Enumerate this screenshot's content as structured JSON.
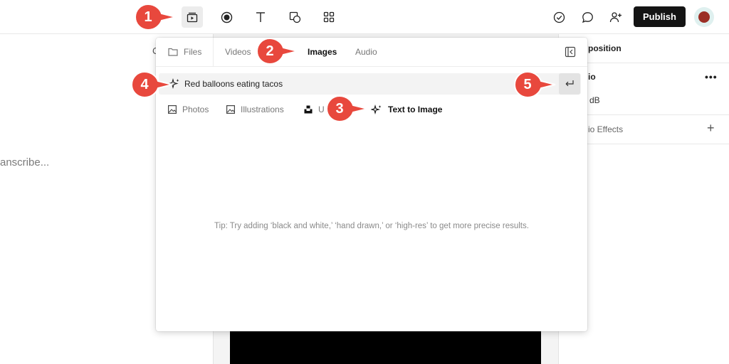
{
  "toolbar": {
    "publish_label": "Publish"
  },
  "background": {
    "transcribe_text": "anscribe...",
    "left_fragment": "C"
  },
  "right_panel": {
    "composition_title": "position",
    "audio_title": "io",
    "volume_unit": "dB",
    "effects_label": "io Effects",
    "more_label": "•••",
    "add_label": "+"
  },
  "media_panel": {
    "tabs": [
      {
        "label": "Files",
        "icon": "folder-icon"
      },
      {
        "label": "Videos"
      },
      {
        "label": "Images",
        "active": true
      },
      {
        "label": "Audio"
      }
    ],
    "search": {
      "value": "Red balloons eating tacos",
      "placeholder": ""
    },
    "sources": [
      {
        "label": "Photos",
        "icon": "image-icon"
      },
      {
        "label": "Illustrations",
        "icon": "image-icon"
      },
      {
        "label": "U",
        "icon": "unsplash-icon"
      },
      {
        "label": "Text to Image",
        "icon": "sparkle-icon",
        "active": true
      }
    ],
    "tip": "Tip: Try adding ‘black and white,’ ‘hand drawn,’ or ‘high-res’ to get more precise results."
  },
  "callouts": [
    "1",
    "2",
    "3",
    "4",
    "5"
  ],
  "colors": {
    "callout_red": "#e8483d",
    "publish_bg": "#141414",
    "avatar": "#9b2f26"
  }
}
